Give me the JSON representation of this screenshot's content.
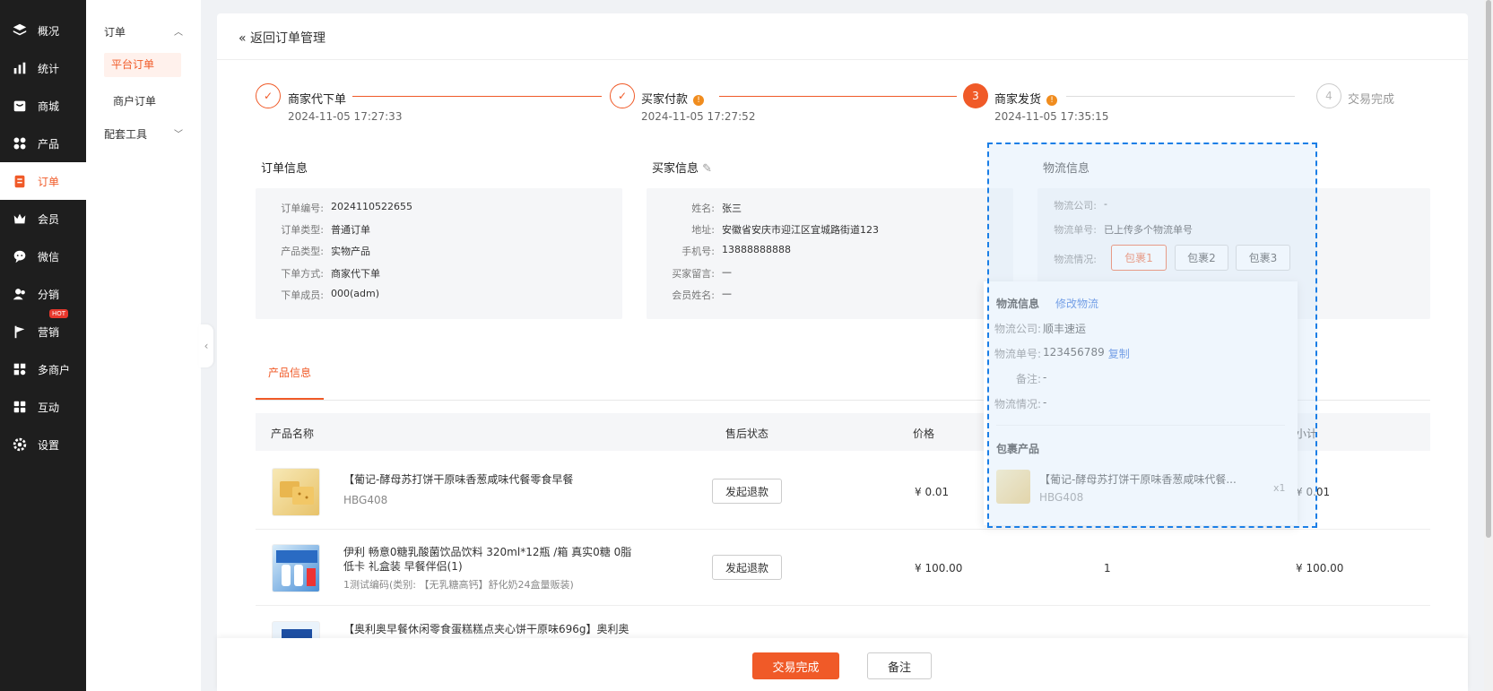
{
  "sidebar": {
    "items": [
      {
        "label": "概况",
        "icon": "layers-icon"
      },
      {
        "label": "统计",
        "icon": "chart-icon"
      },
      {
        "label": "商城",
        "icon": "store-icon"
      },
      {
        "label": "产品",
        "icon": "grid-icon"
      },
      {
        "label": "订单",
        "icon": "order-icon"
      },
      {
        "label": "会员",
        "icon": "crown-icon"
      },
      {
        "label": "微信",
        "icon": "wechat-icon"
      },
      {
        "label": "分销",
        "icon": "users-icon"
      },
      {
        "label": "营销",
        "icon": "flag-icon",
        "badge": "HOT"
      },
      {
        "label": "多商户",
        "icon": "merchant-icon"
      },
      {
        "label": "互动",
        "icon": "apps-icon"
      },
      {
        "label": "设置",
        "icon": "gear-icon"
      }
    ]
  },
  "submenu": {
    "group1": "订单",
    "item_selected": "平台订单",
    "item2": "商户订单",
    "group2": "配套工具"
  },
  "header": {
    "back": "« 返回订单管理"
  },
  "steps": [
    {
      "num": "1",
      "title": "商家代下单",
      "time": "2024-11-05 17:27:33"
    },
    {
      "num": "2",
      "title": "买家付款",
      "time": "2024-11-05 17:27:52"
    },
    {
      "num": "3",
      "title": "商家发货",
      "time": "2024-11-05 17:35:15"
    },
    {
      "num": "4",
      "title": "交易完成",
      "time": ""
    }
  ],
  "order_info": {
    "title": "订单信息",
    "rows": [
      {
        "label": "订单编号:",
        "value": "2024110522655"
      },
      {
        "label": "订单类型:",
        "value": "普通订单"
      },
      {
        "label": "产品类型:",
        "value": "实物产品"
      },
      {
        "label": "下单方式:",
        "value": "商家代下单"
      },
      {
        "label": "下单成员:",
        "value": "000(adm)"
      }
    ]
  },
  "buyer_info": {
    "title": "买家信息",
    "rows": [
      {
        "label": "姓名:",
        "value": "张三"
      },
      {
        "label": "地址:",
        "value": "安徽省安庆市迎江区宜城路街道123"
      },
      {
        "label": "手机号:",
        "value": "13888888888"
      },
      {
        "label": "买家留言:",
        "value": "—"
      },
      {
        "label": "会员姓名:",
        "value": "—"
      }
    ]
  },
  "logistics": {
    "title": "物流信息",
    "rows": [
      {
        "label": "物流公司:",
        "value": "-"
      },
      {
        "label": "物流单号:",
        "value": "已上传多个物流单号"
      },
      {
        "label": "物流情况:",
        "value": ""
      }
    ],
    "packages": [
      "包裹1",
      "包裹2",
      "包裹3"
    ]
  },
  "popover": {
    "title": "物流信息",
    "edit_link": "修改物流",
    "company_label": "物流公司:",
    "company": "顺丰速运",
    "tracking_label": "物流单号:",
    "tracking": "123456789",
    "copy_link": "复制",
    "note_label": "备注:",
    "note": "-",
    "status_label": "物流情况:",
    "status": "-",
    "pkg_title": "包裹产品",
    "pkg_name": "【葡记-酵母苏打饼干原味香葱咸味代餐...",
    "pkg_code": "HBG408",
    "pkg_qty": "x1"
  },
  "tab": {
    "label": "产品信息"
  },
  "table": {
    "headers": [
      "产品名称",
      "售后状态",
      "价格",
      "小计"
    ],
    "rows": [
      {
        "name": "【葡记-酵母苏打饼干原味香葱咸味代餐零食早餐",
        "code": "HBG408",
        "action": "发起退款",
        "price": "¥ 0.01",
        "qty": "",
        "subtotal": "¥ 0.01"
      },
      {
        "name": "伊利 畅意0糖乳酸菌饮品饮料 320ml*12瓶 /箱 真实0糖 0脂低卡 礼盒装 早餐伴侣(1)",
        "code": "1测试编码(类别: 【无乳糖高钙】舒化奶24盒量贩装)",
        "action": "发起退款",
        "price": "¥ 100.00",
        "qty": "1",
        "subtotal": "¥ 100.00"
      },
      {
        "name": "【奥利奥早餐休闲零食蛋糕糕点夹心饼干原味696g】奥利奥",
        "code": "",
        "action": "",
        "price": "",
        "qty": "",
        "subtotal": ""
      }
    ]
  },
  "footer": {
    "complete": "交易完成",
    "note": "备注"
  },
  "colors": {
    "accent": "#f05a28",
    "sidebar": "#1e1e1e",
    "link": "#1f62d6",
    "highlight": "#1a7ee6"
  }
}
